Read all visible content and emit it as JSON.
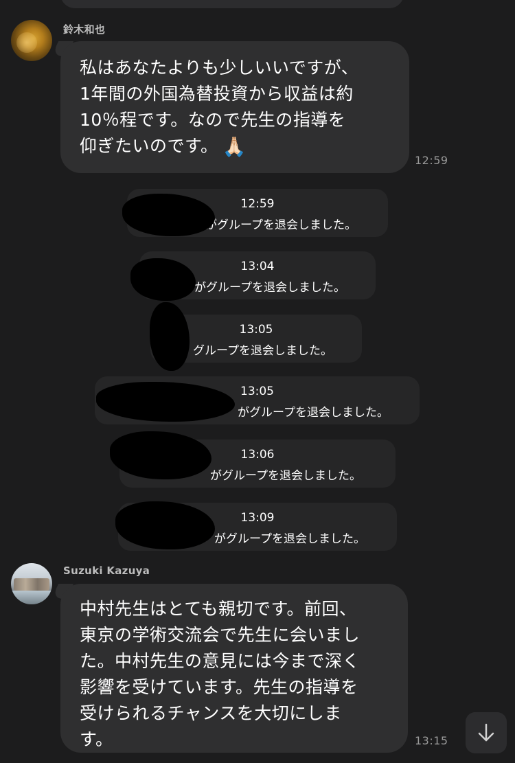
{
  "messages": [
    {
      "sender": "鈴木和也",
      "text": "私はあなたよりも少しいいですが、\n1年間の外国為替投資から収益は約\n10％程です。なので先生の指導を\n仰ぎたいのです。",
      "emoji": "🙏🏻",
      "time": "12:59"
    },
    {
      "sender": "Suzuki Kazuya",
      "text": "中村先生はとても親切です。前回、\n東京の学術交流会で先生に会いまし\nた。中村先生の意見には今まで深く\n影響を受けています。先生の指導を\n受けられるチャンスを大切にしま\nす。",
      "time": "13:15"
    }
  ],
  "notices": [
    {
      "time": "12:59",
      "text": "がグループを退会しました。"
    },
    {
      "time": "13:04",
      "text": "がグループを退会しました。"
    },
    {
      "time": "13:05",
      "text": "グループを退会しました。"
    },
    {
      "time": "13:05",
      "text": "がグループを退会しました。"
    },
    {
      "time": "13:06",
      "text": "がグループを退会しました。"
    },
    {
      "time": "13:09",
      "text": "がグループを退会しました。"
    }
  ],
  "icons": {
    "scroll_down": "arrow-down-icon"
  },
  "colors": {
    "background": "#1c1c1d",
    "bubble": "#2f2f30",
    "notice": "#262627",
    "timestamp": "#9a9a9a"
  }
}
